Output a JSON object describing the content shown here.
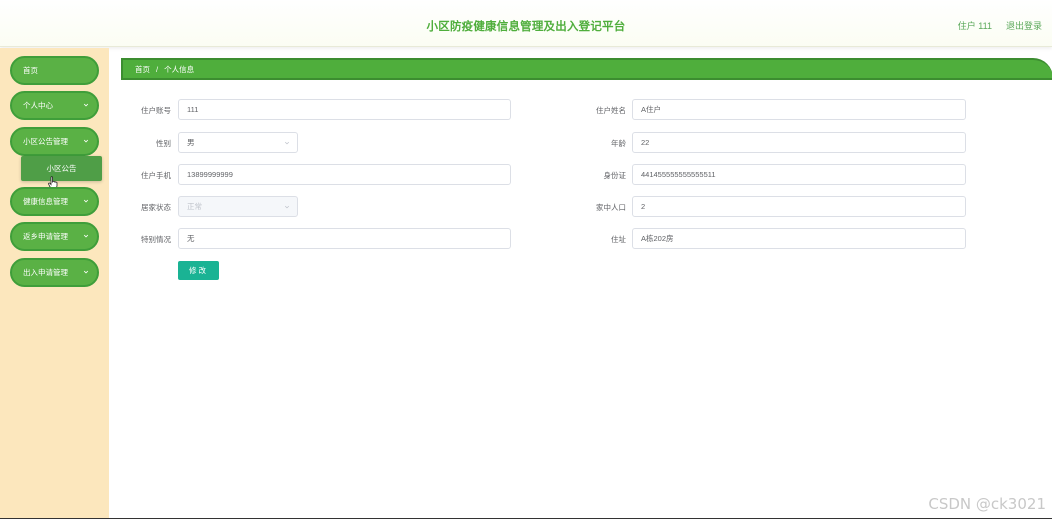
{
  "header": {
    "title": "小区防疫健康信息管理及出入登记平台",
    "user_label": "住户 111",
    "logout_label": "退出登录"
  },
  "sidebar": {
    "items": [
      {
        "label": "首页",
        "has_arrow": false
      },
      {
        "label": "个人中心",
        "has_arrow": true
      },
      {
        "label": "小区公告管理",
        "has_arrow": true
      },
      {
        "label": "健康信息管理",
        "has_arrow": true
      },
      {
        "label": "返乡申请管理",
        "has_arrow": true
      },
      {
        "label": "出入申请管理",
        "has_arrow": true
      }
    ],
    "submenu": {
      "label": "小区公告"
    }
  },
  "breadcrumb": {
    "home": "首页",
    "separator": "/",
    "current": "个人信息"
  },
  "form": {
    "account": {
      "label": "住户账号",
      "value": "111"
    },
    "name": {
      "label": "住户姓名",
      "value": "A住户"
    },
    "gender": {
      "label": "性别",
      "value": "男"
    },
    "age": {
      "label": "年龄",
      "value": "22"
    },
    "phone": {
      "label": "住户手机",
      "value": "13899999999"
    },
    "id_card": {
      "label": "身份证",
      "value": "441455555555555511"
    },
    "home_status": {
      "label": "居家状态",
      "value": "正常"
    },
    "family_count": {
      "label": "家中人口",
      "value": "2"
    },
    "special": {
      "label": "特别情况",
      "value": "无"
    },
    "address": {
      "label": "住址",
      "value": "A栋202房"
    },
    "submit_label": "修改"
  },
  "watermark": "CSDN @ck3021",
  "colors": {
    "primary_green": "#4fae3c",
    "sidebar_bg": "#fce7bd",
    "button_teal": "#1ab394"
  }
}
